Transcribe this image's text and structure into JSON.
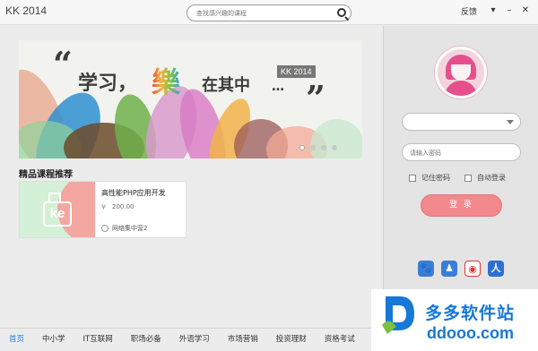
{
  "titlebar": {
    "title": "KK 2014",
    "search_placeholder": "查找感兴趣的课程",
    "feedback": "反馈",
    "menu_glyph": "▾",
    "minimize_glyph": "–",
    "close_glyph": "✕"
  },
  "banner": {
    "quote_open": "“",
    "slogan_part1": "学习，",
    "slogan_char": "樂",
    "slogan_part2": "在其中",
    "slogan_ellipsis": "…",
    "quote_close": "”",
    "badge": "KK 2014",
    "slide_count": 4,
    "active_slide": 1
  },
  "courses": {
    "section_title": "精品课程推荐",
    "items": [
      {
        "thumb_text": "ke",
        "name": "高性能PHP应用开发",
        "price_icon": "¥",
        "price": "200.00",
        "org": "网络集中营2"
      }
    ]
  },
  "login": {
    "account_value": "",
    "password_placeholder": "请输入密码",
    "remember_label": "记住密码",
    "autologin_label": "自动登录",
    "login_button": "登 录",
    "social": [
      {
        "icon": "baidu-icon",
        "glyph": "🐾",
        "color": "#3b7dd8"
      },
      {
        "icon": "qq-icon",
        "glyph": "♟",
        "color": "#3b7dd8"
      },
      {
        "icon": "weibo-icon",
        "glyph": "◉",
        "color": "#e0342f"
      },
      {
        "icon": "renren-icon",
        "glyph": "人",
        "color": "#2f6fd0"
      }
    ]
  },
  "nav": {
    "items": [
      "首页",
      "中小学",
      "IT互联网",
      "职场必备",
      "外语学习",
      "市场营销",
      "投资理财",
      "资格考试"
    ],
    "active_index": 0
  },
  "watermark": {
    "cn": "多多软件站",
    "en": "ddooo.com"
  },
  "colors": {
    "accent": "#2a7be0",
    "login_button": "#f3898c",
    "watermark": "#1778d8"
  }
}
